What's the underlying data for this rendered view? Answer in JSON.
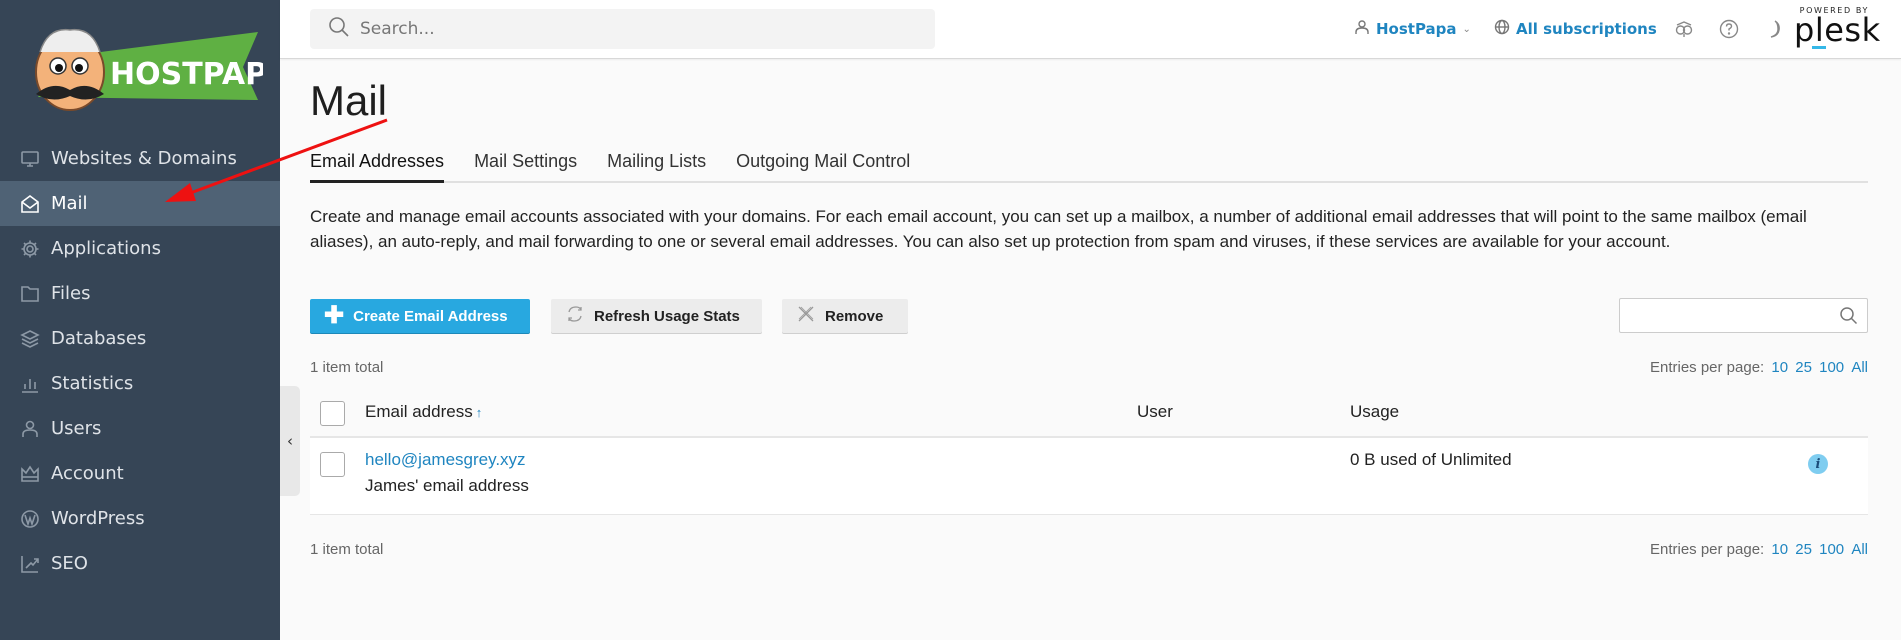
{
  "brand": {
    "name": "HOSTPAPA"
  },
  "sidebar": {
    "items": [
      {
        "label": "Websites & Domains",
        "icon": "monitor-icon"
      },
      {
        "label": "Mail",
        "icon": "envelope-open-icon",
        "active": true
      },
      {
        "label": "Applications",
        "icon": "gear-icon"
      },
      {
        "label": "Files",
        "icon": "folder-icon"
      },
      {
        "label": "Databases",
        "icon": "layers-icon"
      },
      {
        "label": "Statistics",
        "icon": "bar-chart-icon"
      },
      {
        "label": "Users",
        "icon": "user-icon"
      },
      {
        "label": "Account",
        "icon": "crown-icon"
      },
      {
        "label": "WordPress",
        "icon": "wordpress-icon"
      },
      {
        "label": "SEO",
        "icon": "seo-chart-icon"
      }
    ],
    "collapse_glyph": "‹"
  },
  "header": {
    "search_placeholder": "Search...",
    "user_label": "HostPapa",
    "user_chevron": "⌄",
    "subscriptions_label": "All subscriptions",
    "powered_by": "POWERED BY",
    "plesk": "plesk"
  },
  "page": {
    "title": "Mail",
    "tabs": [
      {
        "label": "Email Addresses",
        "active": true
      },
      {
        "label": "Mail Settings"
      },
      {
        "label": "Mailing Lists"
      },
      {
        "label": "Outgoing Mail Control"
      }
    ],
    "description": "Create and manage email accounts associated with your domains. For each email account, you can set up a mailbox, a number of additional email addresses that will point to the same mailbox (email aliases), an auto-reply, and mail forwarding to one or several email addresses. You can also set up protection from spam and viruses, if these services are available for your account."
  },
  "toolbar": {
    "create_label": "Create Email Address",
    "refresh_label": "Refresh Usage Stats",
    "remove_label": "Remove",
    "list_search_value": ""
  },
  "list": {
    "total_text": "1 item total",
    "entries_label": "Entries per page:",
    "page_sizes": [
      "10",
      "25",
      "100",
      "All"
    ],
    "columns": {
      "email": "Email address",
      "sort_glyph": "↑",
      "user": "User",
      "usage": "Usage"
    },
    "rows": [
      {
        "email": "hello@jamesgrey.xyz",
        "description": "James' email address",
        "user": "",
        "usage": "0 B used of Unlimited",
        "info": "i"
      }
    ]
  },
  "colors": {
    "sidebar_bg": "#364556",
    "sidebar_active": "#4f6275",
    "primary_button": "#28a8e0",
    "link": "#1f85c0",
    "annotation_arrow": "#ee1111"
  }
}
